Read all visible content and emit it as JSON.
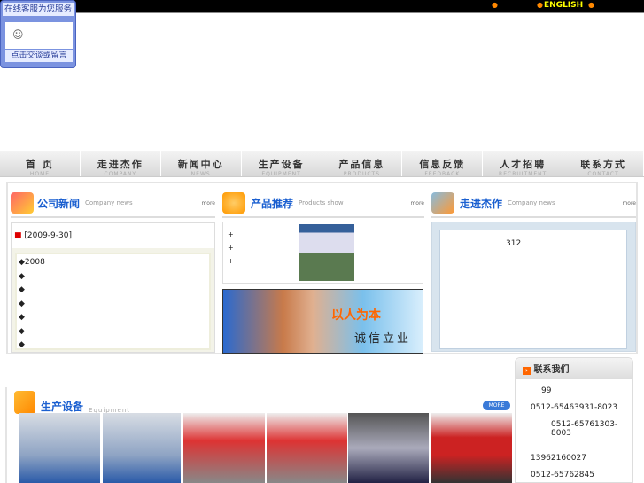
{
  "topbar": {
    "english_label": "ENGLISH"
  },
  "customer_service": {
    "title": "在线客服为您服务",
    "button": "点击交谈或留言"
  },
  "nav": [
    {
      "cn": "首 页",
      "en": "HOME"
    },
    {
      "cn": "走进杰作",
      "en": "COMPANY"
    },
    {
      "cn": "新闻中心",
      "en": "NEWS"
    },
    {
      "cn": "生产设备",
      "en": "EQUIPMENT"
    },
    {
      "cn": "产品信息",
      "en": "PRODUCTS"
    },
    {
      "cn": "信息反馈",
      "en": "FEEDBACK"
    },
    {
      "cn": "人才招聘",
      "en": "RECRUITMENT"
    },
    {
      "cn": "联系方式",
      "en": "CONTACT"
    }
  ],
  "sections": {
    "news": {
      "cn": "公司新闻",
      "en": "Company news",
      "more": "more",
      "date": "[2009-9-30]",
      "items": [
        "◆2008",
        "◆",
        "◆",
        "◆",
        "◆",
        "◆",
        "◆"
      ]
    },
    "products": {
      "cn": "产品推荐",
      "en": "Products show",
      "more": "more",
      "items": [
        "+",
        "+",
        "+"
      ],
      "banner_line1": "以人为本",
      "banner_line2": "诚信立业"
    },
    "company": {
      "cn": "走进杰作",
      "en": "Company news",
      "more": "more",
      "text": "312"
    },
    "equipment": {
      "cn": "生产设备",
      "en": "Equipment",
      "more": "MORE"
    }
  },
  "contact": {
    "title": "联系我们",
    "lines": [
      "99",
      "0512-65463931-8023",
      "0512-65761303-8003",
      "13962160027",
      "0512-65762845"
    ]
  }
}
